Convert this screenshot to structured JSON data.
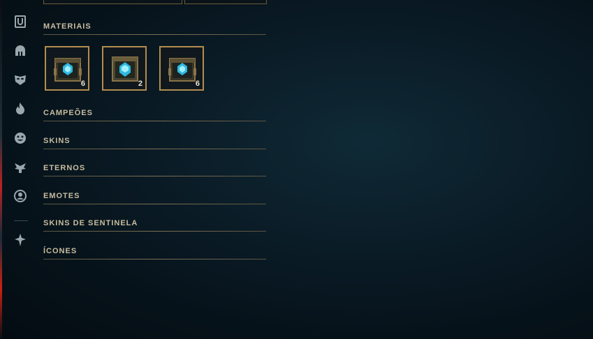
{
  "sections": [
    {
      "label": "MATERIAIS"
    },
    {
      "label": "CAMPEÕES"
    },
    {
      "label": "SKINS"
    },
    {
      "label": "ETERNOS"
    },
    {
      "label": "EMOTES"
    },
    {
      "label": "SKINS DE SENTINELA"
    },
    {
      "label": "ÍCONES"
    }
  ],
  "materials": [
    {
      "name": "hextech-chest",
      "count": "6"
    },
    {
      "name": "hextech-chest",
      "count": "2"
    },
    {
      "name": "hextech-chest",
      "count": "6"
    }
  ],
  "rail": [
    {
      "icon": "loot-icon"
    },
    {
      "icon": "helmet-icon"
    },
    {
      "icon": "mask-icon"
    },
    {
      "icon": "flame-icon"
    },
    {
      "icon": "emote-face-icon"
    },
    {
      "icon": "eternals-icon"
    },
    {
      "icon": "profile-icon-icon"
    },
    {
      "icon": "ward-icon"
    }
  ],
  "colors": {
    "accent_gold": "#b48c4e",
    "text": "#c8bda0",
    "background": "#0b1d28"
  }
}
